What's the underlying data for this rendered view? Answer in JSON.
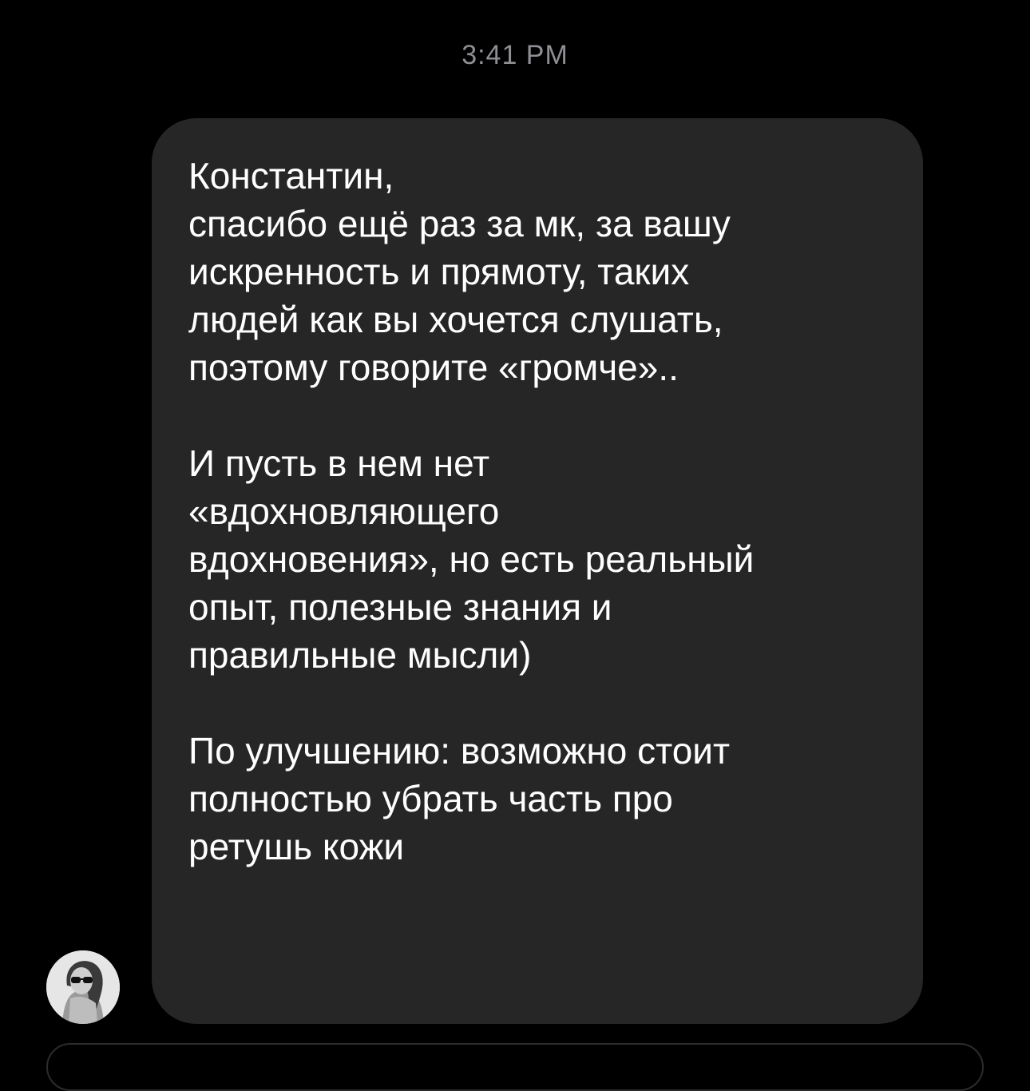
{
  "chat": {
    "timestamp": "3:41 PM",
    "message": {
      "paragraphs": [
        "Константин,\nспасибо ещё раз за мк, за вашу\nискренность и прямоту, таких\nлюдей как вы хочется слушать,\nпоэтому говорите «громче»..",
        "И пусть в нем нет\n«вдохновляющего\nвдохновения», но есть реальный\nопыт, полезные знания и\nправильные мысли)",
        "По улучшению: возможно стоит\nполностью убрать часть про\nретушь кожи"
      ]
    },
    "sender_avatar_icon": "user-avatar-photo"
  }
}
